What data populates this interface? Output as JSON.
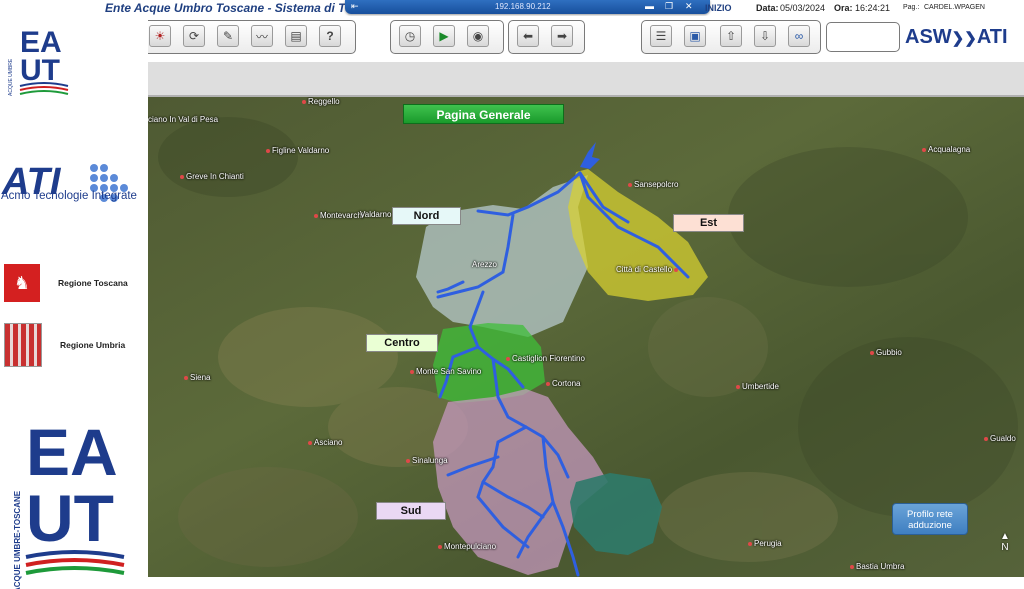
{
  "titlebar": {
    "app_title": "Ente Acque Umbro Toscane - Sistema di Telecontrollo e Telecomando",
    "remote_ip": "192.168.90.212",
    "current_page": "INIZIO",
    "date_label": "Data:",
    "date_value": "05/03/2024",
    "time_label": "Ora:",
    "time_value": "16:24:21",
    "page_label": "Pag.:",
    "page_value": "CARDEL.WPAGEN"
  },
  "toolbar": {
    "brand_logo": "ASW",
    "brand_logo_suffix": "ATI"
  },
  "sidebar": {
    "logo_eaut_small": "EAUT",
    "ati_logo_text": "ATI",
    "ati_tagline": "Acmo Tecnologie Integrate",
    "regions": [
      {
        "label": "Regione Toscana"
      },
      {
        "label": "Regione Umbria"
      }
    ],
    "logo_eaut_big_tagline": "ACQUE UMBRE-TOSCANE"
  },
  "map": {
    "page_button": "Pagina Generale",
    "zones": {
      "nord": "Nord",
      "est": "Est",
      "centro": "Centro",
      "sud": "Sud"
    },
    "profile_button": "Profilo rete adduzione",
    "north_label": "N",
    "towns": [
      {
        "name": "Reggello"
      },
      {
        "name": "Figline Valdarno"
      },
      {
        "name": "Greve In Chianti"
      },
      {
        "name": "Montevarchi"
      },
      {
        "name": "Arezzo"
      },
      {
        "name": "Sansepolcro"
      },
      {
        "name": "Città di Castello"
      },
      {
        "name": "Castiglion Fiorentino"
      },
      {
        "name": "Monte San Savino"
      },
      {
        "name": "Cortona"
      },
      {
        "name": "Siena"
      },
      {
        "name": "Asciano"
      },
      {
        "name": "Sinalunga"
      },
      {
        "name": "Montepulciano"
      },
      {
        "name": "Umbertide"
      },
      {
        "name": "Gubbio"
      },
      {
        "name": "Perugia"
      },
      {
        "name": "Bastia Umbra"
      },
      {
        "name": "Gualdo"
      },
      {
        "name": "Acqualagna"
      },
      {
        "name": "Valdarno"
      },
      {
        "name": "ciano In Val di Pesa"
      }
    ]
  },
  "colors": {
    "zone_nord": "#b7c9cc",
    "zone_est": "#d9d231",
    "zone_centro": "#3fbf3a",
    "zone_sud": "#c99ac2",
    "pipeline": "#2f5fe0",
    "brand_blue": "#1e3c8c"
  }
}
